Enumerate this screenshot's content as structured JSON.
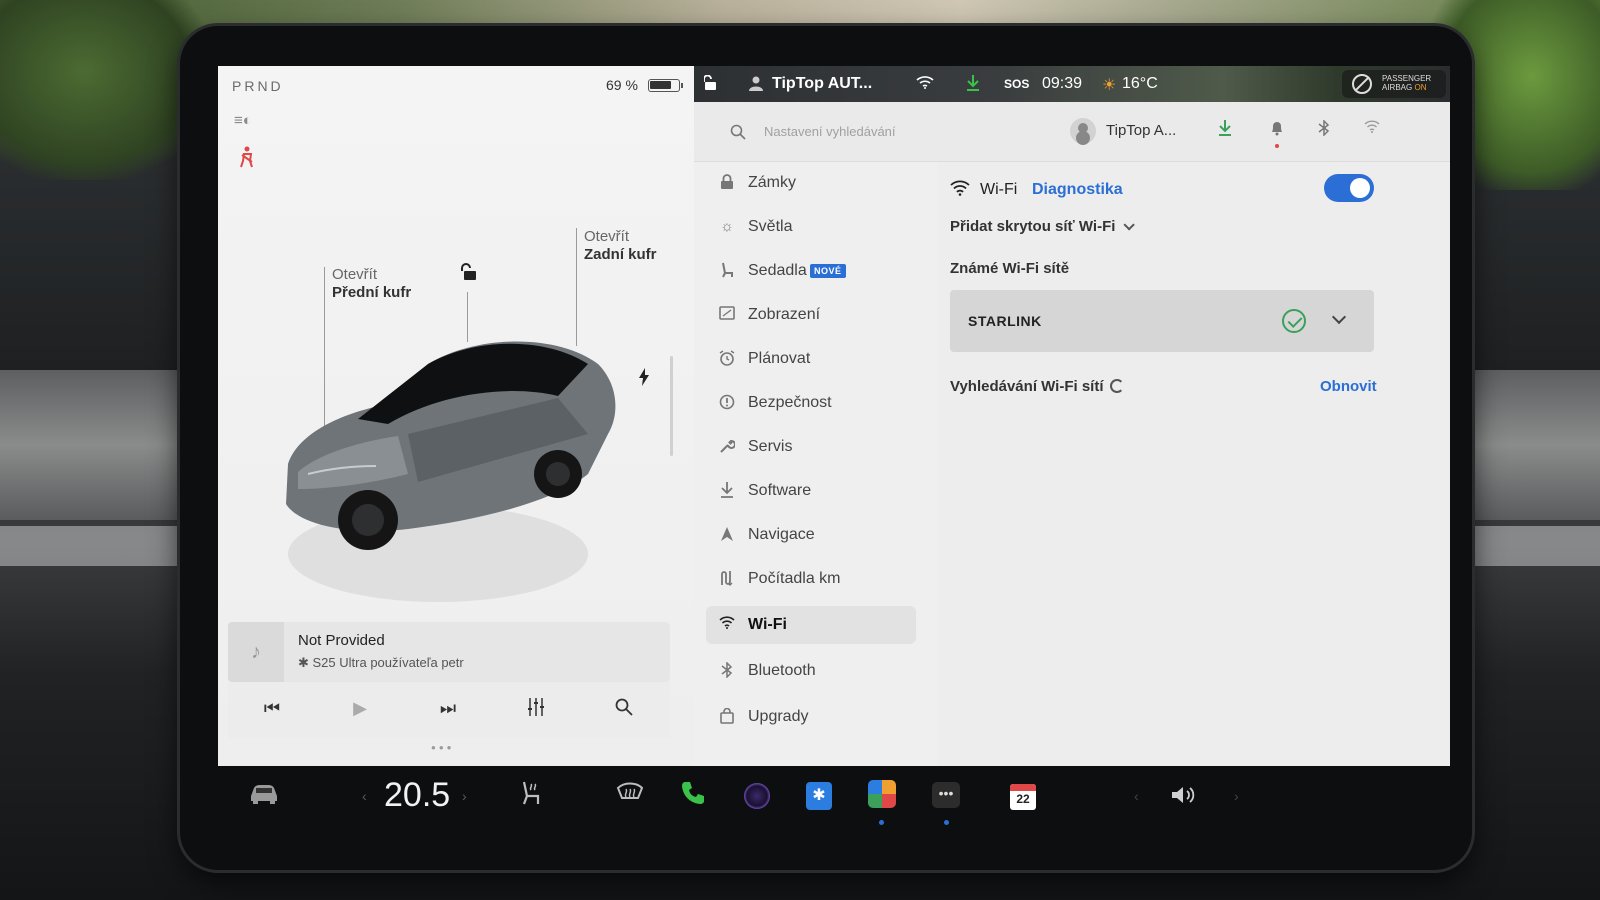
{
  "left_panel": {
    "gear": "PRND",
    "battery_pct": "69 %",
    "front_trunk": {
      "line1": "Otevřít",
      "line2": "Přední kufr"
    },
    "rear_trunk": {
      "line1": "Otevřít",
      "line2": "Zadní kufr"
    },
    "icons": [
      "headlight-icon",
      "seatbelt-warning-icon",
      "unlock-icon",
      "charge-port-icon"
    ]
  },
  "media": {
    "title": "Not Provided",
    "subtitle": "S25 Ultra používateľa petr",
    "controls": [
      "previous-track",
      "play",
      "next-track",
      "equalizer",
      "search"
    ]
  },
  "status_bar": {
    "profile": "TipTop AUT...",
    "sos": "SOS",
    "time": "09:39",
    "temperature": "16°C",
    "airbag_line1": "PASSENGER",
    "airbag_line2": "AIRBAG",
    "airbag_state": "ON"
  },
  "settings_header": {
    "search_placeholder": "Nastavení vyhledávání",
    "profile_name": "TipTop A..."
  },
  "sidebar": {
    "items": [
      {
        "label": "Zámky",
        "icon": "lock-icon"
      },
      {
        "label": "Světla",
        "icon": "sun-icon"
      },
      {
        "label": "Sedadla",
        "icon": "seat-icon",
        "badge": "NOVÉ"
      },
      {
        "label": "Zobrazení",
        "icon": "display-icon"
      },
      {
        "label": "Plánovat",
        "icon": "alarm-clock-icon"
      },
      {
        "label": "Bezpečnost",
        "icon": "info-circle-icon"
      },
      {
        "label": "Servis",
        "icon": "wrench-icon"
      },
      {
        "label": "Software",
        "icon": "download-icon"
      },
      {
        "label": "Navigace",
        "icon": "navigation-arrow-icon"
      },
      {
        "label": "Počítadla km",
        "icon": "odometer-icon"
      },
      {
        "label": "Wi-Fi",
        "icon": "wifi-icon",
        "active": true
      },
      {
        "label": "Bluetooth",
        "icon": "bluetooth-icon"
      },
      {
        "label": "Upgrady",
        "icon": "shopping-bag-icon"
      }
    ]
  },
  "wifi": {
    "title": "Wi-Fi",
    "diagnostics": "Diagnostika",
    "enabled": true,
    "add_hidden": "Přidat skrytou síť Wi-Fi",
    "known_title": "Známé Wi-Fi sítě",
    "known_networks": [
      {
        "name": "STARLINK",
        "connected": true
      }
    ],
    "scanning_label": "Vyhledávání Wi-Fi sítí",
    "refresh": "Obnovit"
  },
  "dock": {
    "cabin_temp": "20.5",
    "calendar_day": "22",
    "items": [
      "car-icon",
      "seat-heater-icon",
      "rear-defrost-icon",
      "phone-icon",
      "camera-icon",
      "bluetooth-icon",
      "apps-icon",
      "more-icon",
      "calendar-icon",
      "volume-icon"
    ]
  },
  "colors": {
    "accent": "#2b6fd6",
    "success": "#3aa05a",
    "warning": "#e04848",
    "phone": "#3ac24a"
  }
}
